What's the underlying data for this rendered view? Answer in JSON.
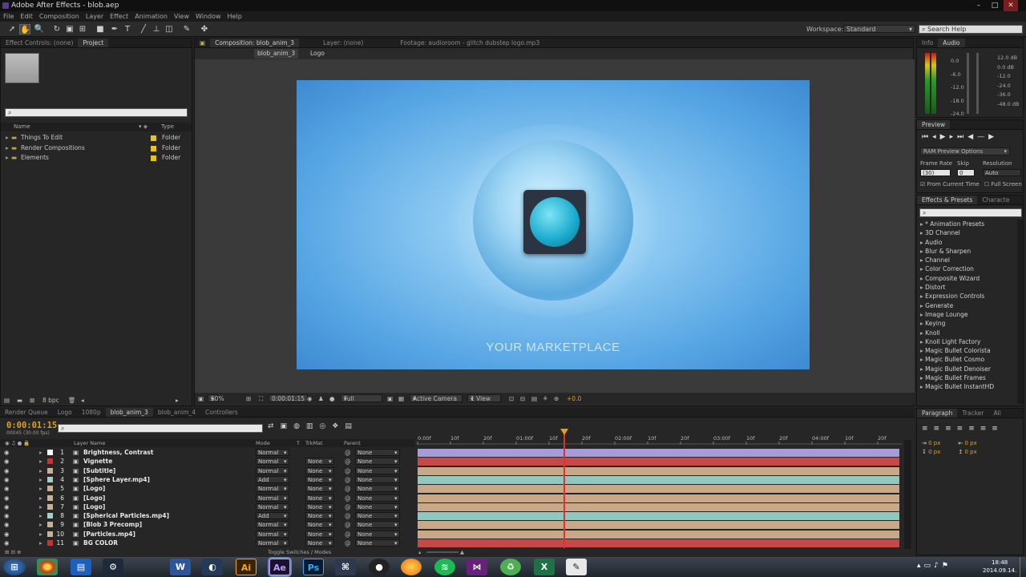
{
  "window": {
    "title": "Adobe After Effects - blob.aep"
  },
  "menu": [
    "File",
    "Edit",
    "Composition",
    "Layer",
    "Effect",
    "Animation",
    "View",
    "Window",
    "Help"
  ],
  "toolbar": {
    "workspace_label": "Workspace:",
    "workspace_value": "Standard",
    "search_help": "Search Help"
  },
  "project": {
    "tabs": [
      "Effect Controls: (none)",
      "Project"
    ],
    "columns": {
      "name": "Name",
      "type": "Type"
    },
    "items": [
      {
        "name": "Things To Edit",
        "type": "Folder"
      },
      {
        "name": "Render Compositions",
        "type": "Folder"
      },
      {
        "name": "Elements",
        "type": "Folder"
      }
    ],
    "bpc": "8 bpc"
  },
  "viewer": {
    "tabs": [
      "Composition: blob_anim_3",
      "Layer: (none)",
      "Footage: audioroom - glitch dubstep logo.mp3"
    ],
    "crumbs": [
      "blob_anim_3",
      "Logo"
    ],
    "comp_text": "YOUR MARKETPLACE",
    "zoom": "50%",
    "timecode": "0:00:01:15",
    "resolution": "Full",
    "camera": "Active Camera",
    "views": "1 View",
    "exposure": "+0.0"
  },
  "info": {
    "tabs": [
      "Info",
      "Audio"
    ],
    "db_left": [
      "0.0",
      "-6.0",
      "-12.0",
      "-18.0",
      "-24.0"
    ],
    "db_right": [
      "12.0 dB",
      "0.0 dB",
      "-12.0",
      "-24.0",
      "-36.0",
      "-48.0 dB"
    ]
  },
  "preview": {
    "tab": "Preview",
    "ram": "RAM Preview Options",
    "frame_rate_label": "Frame Rate",
    "skip_label": "Skip",
    "resolution_label": "Resolution",
    "frame_rate": "(30)",
    "skip": "0",
    "resolution": "Auto",
    "from_current": "From Current Time",
    "full_screen": "Full Screen"
  },
  "effects": {
    "tabs": [
      "Effects & Presets",
      "Characte"
    ],
    "items": [
      "* Animation Presets",
      "3D Channel",
      "Audio",
      "Blur & Sharpen",
      "Channel",
      "Color Correction",
      "Composite Wizard",
      "Distort",
      "Expression Controls",
      "Generate",
      "Image Lounge",
      "Keying",
      "Knoll",
      "Knoll Light Factory",
      "Magic Bullet Colorista",
      "Magic Bullet Cosmo",
      "Magic Bullet Denoiser",
      "Magic Bullet Frames",
      "Magic Bullet InstantHD"
    ]
  },
  "paragraph": {
    "tabs": [
      "Paragraph",
      "Tracker",
      "Ali"
    ],
    "v1": "0 px",
    "v2": "0 px",
    "v3": "0 px",
    "v4": "0 px"
  },
  "timeline": {
    "tabs": [
      "Render Queue",
      "Logo",
      "1080p",
      "blob_anim_3",
      "blob_anim_4",
      "Controllers"
    ],
    "timecode": "0:00:01:15",
    "fps": "00045 (30.00 fps)",
    "col_headers": {
      "layer_name": "Layer Name",
      "mode": "Mode",
      "t": "T",
      "trkmat": "TrkMat",
      "parent": "Parent"
    },
    "ruler": [
      "0:00f",
      "10f",
      "20f",
      "01:00f",
      "10f",
      "20f",
      "02:00f",
      "10f",
      "20f",
      "03:00f",
      "10f",
      "20f",
      "04:00f",
      "10f",
      "20f"
    ],
    "toggle": "Toggle Switches / Modes",
    "layers": [
      {
        "num": "1",
        "name": "Brightness, Contrast",
        "mode": "Normal",
        "trkmat": "",
        "parent": "None",
        "label": "#ffffff",
        "bar": "#a69cd8"
      },
      {
        "num": "2",
        "name": "Vignette",
        "mode": "Normal",
        "trkmat": "None",
        "parent": "None",
        "label": "#c83232",
        "bar": "#c84848"
      },
      {
        "num": "3",
        "name": "[Subtitle]",
        "mode": "Normal",
        "trkmat": "None",
        "parent": "None",
        "label": "#c8b090",
        "bar": "#c8a888"
      },
      {
        "num": "4",
        "name": "[Sphere Layer.mp4]",
        "mode": "Add",
        "trkmat": "None",
        "parent": "None",
        "label": "#a0d0c8",
        "bar": "#90c8c0"
      },
      {
        "num": "5",
        "name": "[Logo]",
        "mode": "Normal",
        "trkmat": "None",
        "parent": "None",
        "label": "#c8b090",
        "bar": "#c8a888"
      },
      {
        "num": "6",
        "name": "[Logo]",
        "mode": "Normal",
        "trkmat": "None",
        "parent": "None",
        "label": "#c8b090",
        "bar": "#c8a888"
      },
      {
        "num": "7",
        "name": "[Logo]",
        "mode": "Normal",
        "trkmat": "None",
        "parent": "None",
        "label": "#c8b090",
        "bar": "#c8a888"
      },
      {
        "num": "8",
        "name": "[Spherical Particles.mp4]",
        "mode": "Add",
        "trkmat": "None",
        "parent": "None",
        "label": "#a0d0c8",
        "bar": "#90c8c0"
      },
      {
        "num": "9",
        "name": "[Blob 3 Precomp]",
        "mode": "Normal",
        "trkmat": "None",
        "parent": "None",
        "label": "#c8b090",
        "bar": "#c8a888"
      },
      {
        "num": "10",
        "name": "[Particles.mp4]",
        "mode": "Normal",
        "trkmat": "None",
        "parent": "None",
        "label": "#c8b090",
        "bar": "#c8a888"
      },
      {
        "num": "11",
        "name": "BG COLOR",
        "mode": "Normal",
        "trkmat": "None",
        "parent": "None",
        "label": "#c83232",
        "bar": "#c84848"
      }
    ]
  },
  "taskbar": {
    "time": "18:48",
    "date": "2014.09.14.",
    "apps": [
      "chrome",
      "explorer",
      "steam",
      "word",
      "vs",
      "Ai",
      "Ae",
      "Ps",
      "cinema4d",
      "obs",
      "firefox",
      "spotify",
      "vs2",
      "green",
      "excel",
      "notepad"
    ]
  }
}
